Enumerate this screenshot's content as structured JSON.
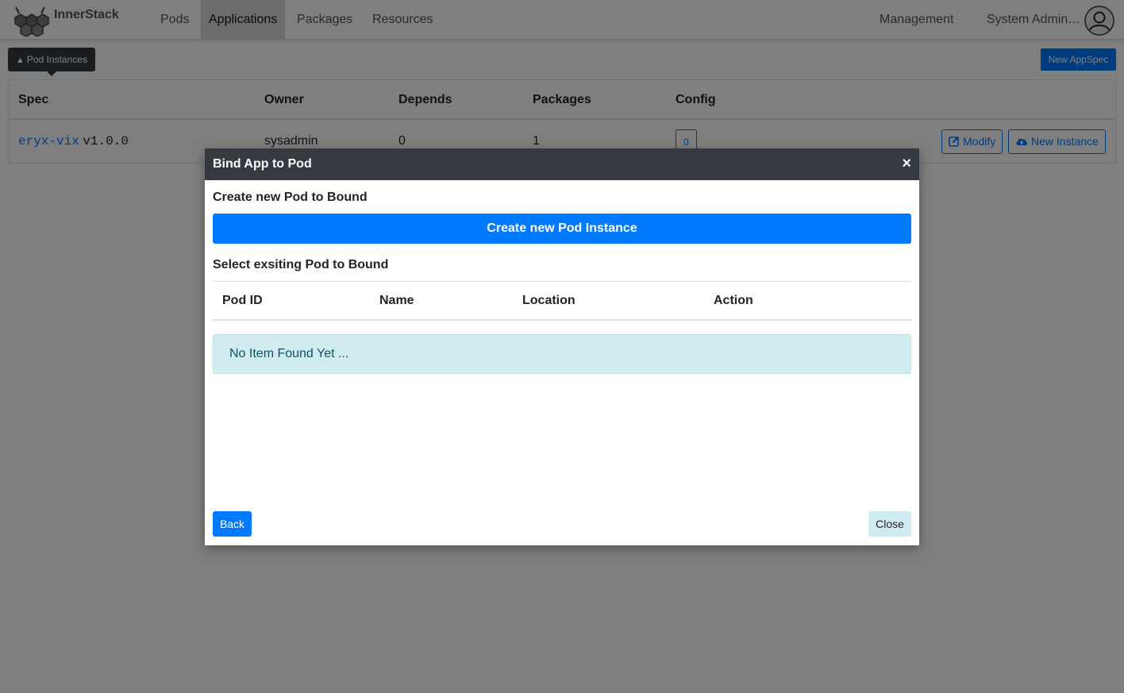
{
  "navbar": {
    "brand": "InnerStack",
    "items": [
      {
        "label": "Pods",
        "active": false
      },
      {
        "label": "Applications",
        "active": true
      },
      {
        "label": "Packages",
        "active": false
      },
      {
        "label": "Resources",
        "active": false
      }
    ],
    "management": "Management",
    "user": "System Admin…",
    "logo_icon": "hexagon-cluster-icon",
    "avatar_icon": "user-circle-icon"
  },
  "toolbar": {
    "pod_instances_label": "Pod Instances",
    "pod_instances_icon": "cubes-icon",
    "new_appspec_label": "New AppSpec"
  },
  "app_table": {
    "headers": [
      "Spec",
      "Owner",
      "Depends",
      "Packages",
      "Config"
    ],
    "rows": [
      {
        "spec_name": "eryx-vix",
        "spec_version": "v1.0.0",
        "owner": "sysadmin",
        "depends": "0",
        "packages": "1",
        "config": "0",
        "modify_label": "Modify",
        "new_instance_label": "New Instance"
      }
    ]
  },
  "modal": {
    "title": "Bind App to Pod",
    "close_icon": "×",
    "create_section_label": "Create new Pod to Bound",
    "create_button_label": "Create new Pod Instance",
    "select_section_label": "Select exsiting Pod to Bound",
    "table_headers": [
      "Pod ID",
      "Name",
      "Location",
      "Action"
    ],
    "empty_message": "No Item Found Yet ...",
    "back_label": "Back",
    "close_label": "Close"
  },
  "colors": {
    "primary": "#007bff",
    "dark": "#343a40",
    "info_bg": "#d1ecf1",
    "info_text": "#0c5460"
  }
}
